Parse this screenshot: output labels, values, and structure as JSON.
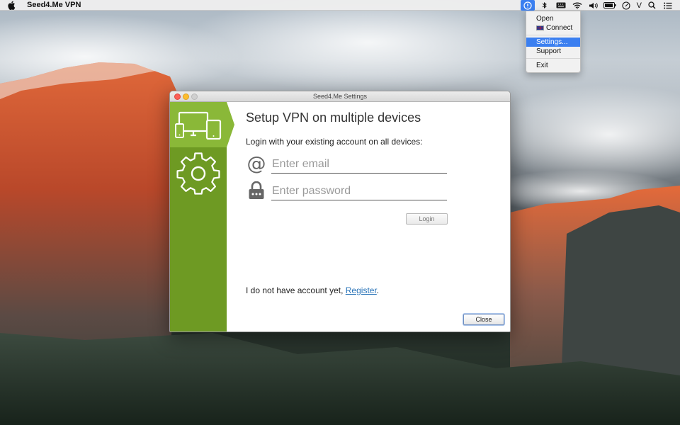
{
  "menubar": {
    "app_name": "Seed4.Me VPN",
    "right_text": "V",
    "icons": [
      "apple-icon",
      "seed4me-tray-icon",
      "bluetooth-icon",
      "keyboard-icon",
      "wifi-icon",
      "volume-icon",
      "battery-icon",
      "clock-icon",
      "spotlight-icon",
      "notification-center-icon"
    ]
  },
  "tray_menu": {
    "items": [
      "Open",
      "Connect",
      "Settings...",
      "Support",
      "Exit"
    ],
    "highlighted": "Settings..."
  },
  "window": {
    "title": "Seed4.Me Settings",
    "heading": "Setup VPN on multiple devices",
    "instruction": "Login with your existing account on all devices:",
    "email_placeholder": "Enter email",
    "email_value": "",
    "password_placeholder": "Enter password",
    "password_value": "",
    "at_symbol": "@",
    "login_label": "Login",
    "register_prefix": "I do not have account yet, ",
    "register_link": "Register",
    "register_suffix": ".",
    "close_label": "Close",
    "sidebar_tabs": [
      "devices-tab",
      "settings-tab"
    ]
  },
  "colors": {
    "sidebar_dark": "#6e9a23",
    "sidebar_active": "#8ab838",
    "menu_highlight": "#3b7ff0",
    "link": "#2a74b8"
  }
}
